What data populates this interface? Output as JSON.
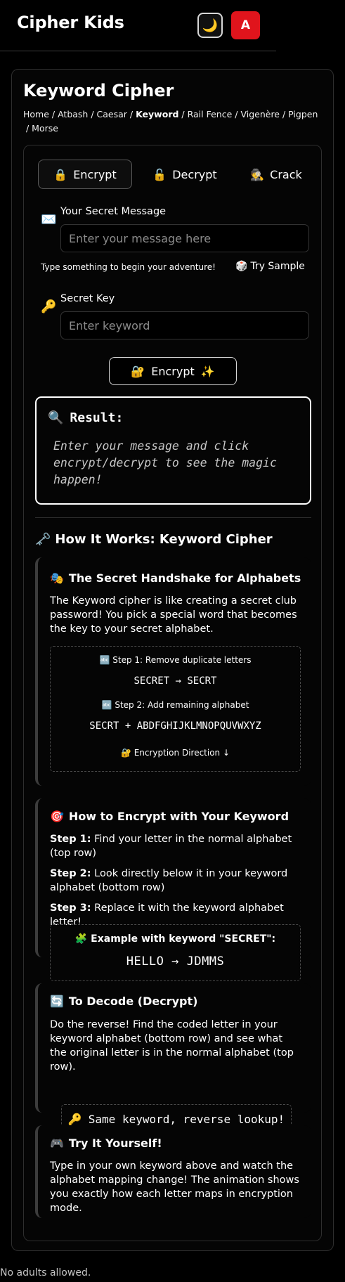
{
  "header": {
    "app_title": "Cipher Kids",
    "theme_icon": "moon-icon",
    "theme_glyph": "🌙",
    "avatar_letter": "A",
    "avatar_color": "#e0141c"
  },
  "page": {
    "title": "Keyword Cipher",
    "breadcrumb": [
      {
        "label": "Home"
      },
      {
        "label": "Atbash"
      },
      {
        "label": "Caesar"
      },
      {
        "label": "Keyword",
        "current": true
      },
      {
        "label": "Rail Fence"
      },
      {
        "label": "Vigenère"
      },
      {
        "label": "Pigpen"
      },
      {
        "label": "Morse"
      }
    ],
    "breadcrumb_separator": " / "
  },
  "tabs": [
    {
      "icon": "🔒",
      "label": "Encrypt",
      "active": true
    },
    {
      "icon": "🔓",
      "label": "Decrypt",
      "active": false
    },
    {
      "icon": "🕵️",
      "label": "Crack",
      "active": false
    }
  ],
  "message_field": {
    "icon": "✉️",
    "label": "Your Secret Message",
    "placeholder": "Enter your message here",
    "value": ""
  },
  "hint": "Type something to begin your adventure!",
  "try_sample": {
    "icon": "🎲",
    "label": "Try Sample"
  },
  "key_field": {
    "icon": "🔑",
    "label": "Secret Key",
    "placeholder": "Enter keyword",
    "value": ""
  },
  "encrypt_button": {
    "icon": "🔐",
    "label": "Encrypt",
    "sparkle": "✨"
  },
  "result": {
    "icon": "🔍",
    "title": "Result:",
    "text": "Enter your message and click encrypt/decrypt to see the magic happen!"
  },
  "how_it_works": {
    "icon": "🗝️",
    "title": "How It Works: Keyword Cipher"
  },
  "card1": {
    "icon": "🎭",
    "title": "The Secret Handshake for Alphabets",
    "text": "The Keyword cipher is like creating a secret club password! You pick a special word that becomes the key to your secret alphabet.",
    "step1_caption": "🔤 Step 1: Remove duplicate letters",
    "step1_code": "SECRET → SECRT",
    "step2_caption": "🔤 Step 2: Add remaining alphabet",
    "step2_code": "SECRT + ABDFGHIJKLMNOPQUVWXYZ",
    "direction": "🔐 Encryption Direction ↓"
  },
  "card2": {
    "icon": "🎯",
    "title": "How to Encrypt with Your Keyword",
    "steps": [
      {
        "label": "Step 1:",
        "text": " Find your letter in the normal alphabet (top row)"
      },
      {
        "label": "Step 2:",
        "text": " Look directly below it in your keyword alphabet (bottom row)"
      },
      {
        "label": "Step 3:",
        "text": " Replace it with the keyword alphabet letter!"
      }
    ],
    "example_label": "🧩 Example with keyword \"SECRET\":",
    "example_code": "HELLO → JDMMS"
  },
  "card3": {
    "icon": "🔄",
    "title": "To Decode (Decrypt)",
    "text": "Do the reverse! Find the coded letter in your keyword alphabet (bottom row) and see what the original letter is in the normal alphabet (top row).",
    "box_icon": "🔑",
    "box_text": "Same keyword, reverse lookup!"
  },
  "card4": {
    "icon": "🎮",
    "title": "Try It Yourself!",
    "text": "Type in your own keyword above and watch the alphabet mapping change! The animation shows you exactly how each letter maps in encryption mode."
  },
  "footer": "No adults allowed."
}
